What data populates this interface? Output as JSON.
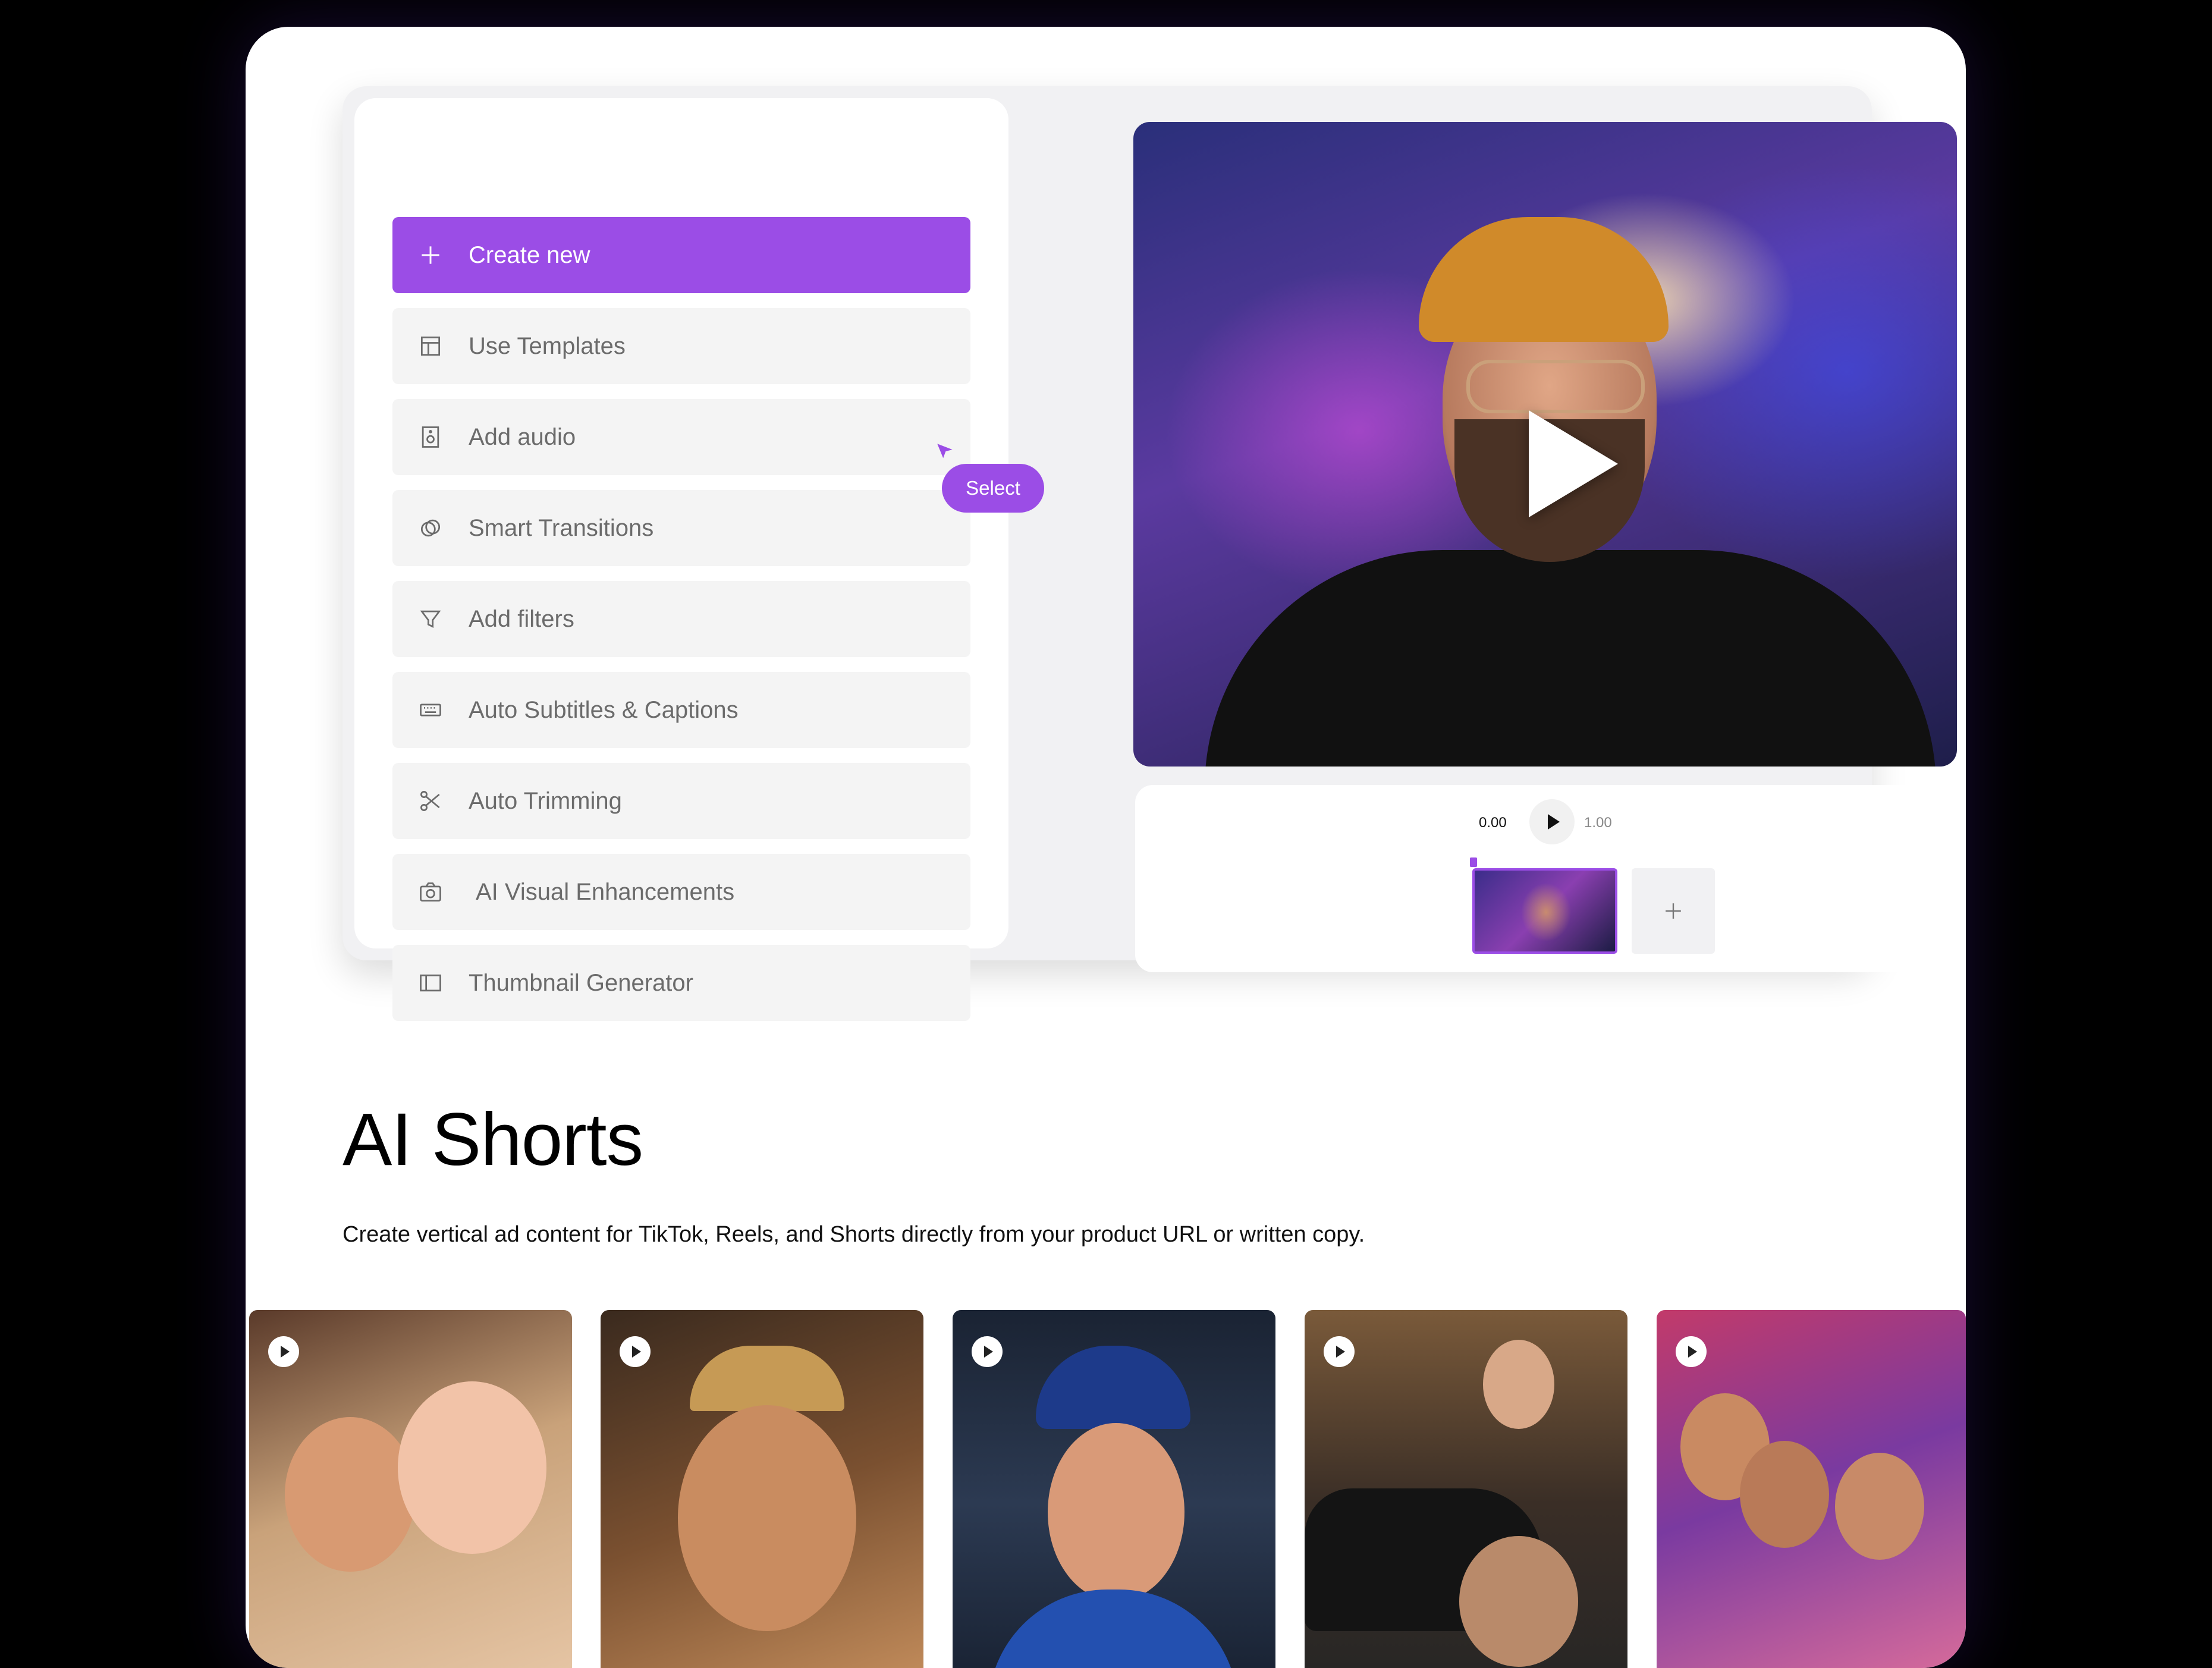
{
  "menu": {
    "items": [
      {
        "label": "Create new",
        "icon": "plus-icon",
        "primary": true
      },
      {
        "label": "Use Templates",
        "icon": "template-icon"
      },
      {
        "label": "Add audio",
        "icon": "audio-file-icon"
      },
      {
        "label": "Smart Transitions",
        "icon": "transitions-icon"
      },
      {
        "label": "Add filters",
        "icon": "filter-icon"
      },
      {
        "label": "Auto Subtitles & Captions",
        "icon": "keyboard-icon"
      },
      {
        "label": "Auto Trimming",
        "icon": "scissors-icon"
      },
      {
        "label": "AI Visual Enhancements",
        "icon": "camera-icon"
      },
      {
        "label": "Thumbnail Generator",
        "icon": "sidebar-layout-icon"
      }
    ],
    "select_label": "Select"
  },
  "timeline": {
    "time_start": "0.00",
    "time_end": "1.00"
  },
  "section": {
    "title": "AI Shorts",
    "subtitle": "Create vertical ad content for TikTok, Reels, and Shorts directly from your product URL or written copy."
  },
  "colors": {
    "accent": "#9b4de6",
    "background": "#000000",
    "panel": "#ffffff",
    "item_bg": "#f4f4f4"
  }
}
